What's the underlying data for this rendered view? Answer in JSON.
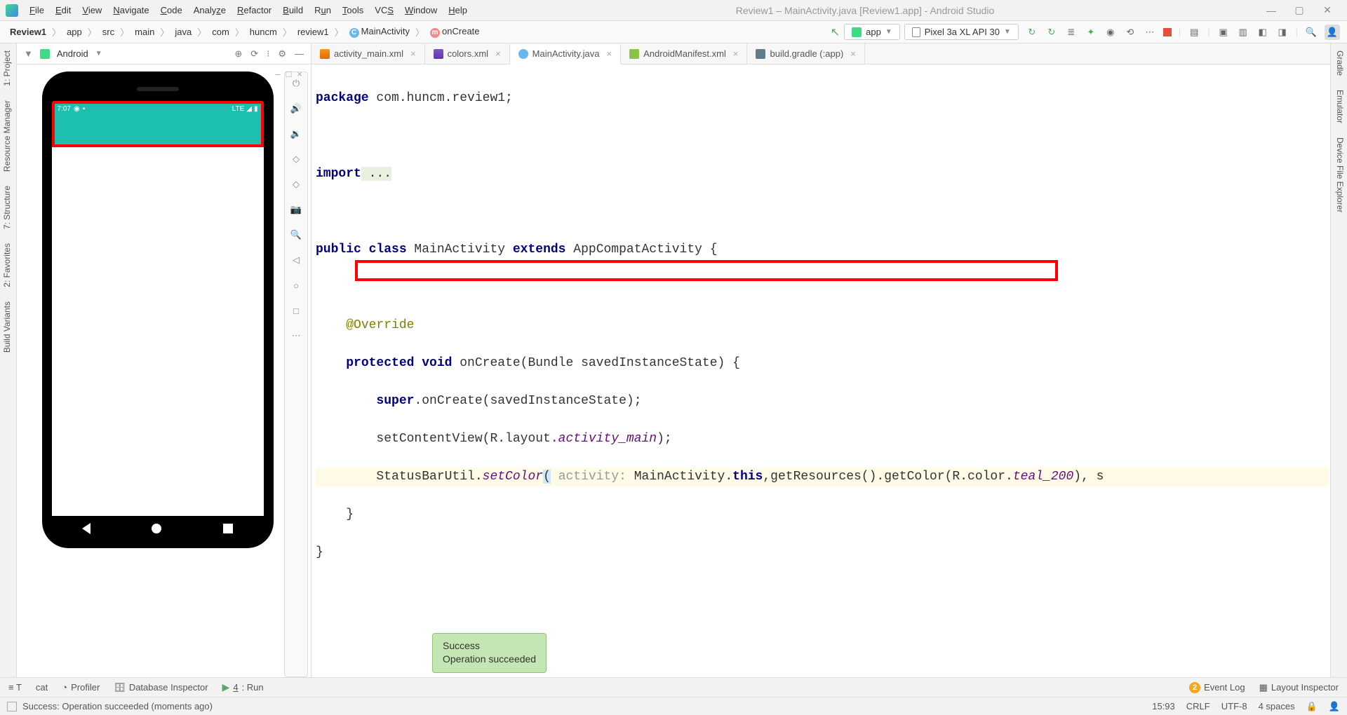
{
  "window": {
    "title": "Review1 – MainActivity.java [Review1.app] - Android Studio"
  },
  "menu": {
    "items": [
      "File",
      "Edit",
      "View",
      "Navigate",
      "Code",
      "Analyze",
      "Refactor",
      "Build",
      "Run",
      "Tools",
      "VCS",
      "Window",
      "Help"
    ]
  },
  "breadcrumb": {
    "parts": [
      "Review1",
      "app",
      "src",
      "main",
      "java",
      "com",
      "huncm",
      "review1",
      "MainActivity",
      "onCreate"
    ]
  },
  "runconfig": {
    "config_label": "app",
    "device_label": "Pixel 3a XL API 30"
  },
  "left_tools": [
    "1: Project",
    "Resource Manager",
    "7: Structure",
    "2: Favorites",
    "Build Variants"
  ],
  "right_tools": [
    "Gradle",
    "Emulator",
    "Device File Explorer"
  ],
  "emulator": {
    "panel_label": "Android",
    "status_time": "7:07",
    "status_net": "LTE"
  },
  "tabs": [
    {
      "label": "activity_main.xml",
      "icon": "fi-xml"
    },
    {
      "label": "colors.xml",
      "icon": "fi-xml2"
    },
    {
      "label": "MainActivity.java",
      "icon": "fi-java",
      "active": true
    },
    {
      "label": "AndroidManifest.xml",
      "icon": "fi-mf"
    },
    {
      "label": "build.gradle (:app)",
      "icon": "fi-gradle"
    }
  ],
  "code": {
    "l1_kw": "package",
    "l1_rest": " com.huncm.review1;",
    "l3_kw": "import",
    "l3_rest": " ...",
    "l5_kw1": "public class",
    "l5_name": " MainActivity ",
    "l5_kw2": "extends",
    "l5_rest": " AppCompatActivity {",
    "l7_ann": "@Override",
    "l8_kw1": "protected void",
    "l8_name": " onCreate(Bundle savedInstanceState) {",
    "l9_kw": "super",
    "l9_rest": ".onCreate(savedInstanceState);",
    "l10_a": "setContentView(R.layout.",
    "l10_i": "activity_main",
    "l10_b": ");",
    "l11_a": "StatusBarUtil.",
    "l11_m": "setColor",
    "l11_open": "(",
    "l11_hint": " activity: ",
    "l11_b": "MainActivity.",
    "l11_kw": "this",
    "l11_c": ",getResources().getColor(R.color.",
    "l11_i": "teal_200",
    "l11_d": "), s",
    "l12": "    }",
    "l13": "}"
  },
  "bottom_tools": {
    "left": [
      "T",
      "cat",
      "Profiler",
      "Database Inspector",
      "4: Run"
    ],
    "profiler": "Profiler",
    "db": "Database Inspector",
    "run_u": "4",
    "run_rest": ": Run",
    "eventlog": "Event Log",
    "layout": "Layout Inspector",
    "event_count": "2"
  },
  "toast": {
    "title": "Success",
    "body": "Operation succeeded"
  },
  "status": {
    "msg": "Success: Operation succeeded (moments ago)",
    "cursor": "15:93",
    "eol": "CRLF",
    "enc": "UTF-8",
    "indent": "4 spaces"
  }
}
